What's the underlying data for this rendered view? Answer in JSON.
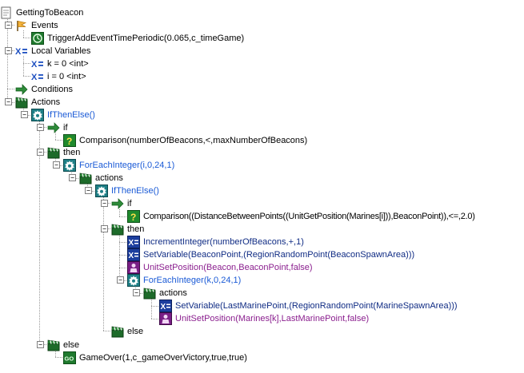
{
  "tree": {
    "root": "GettingToBeacon",
    "events_label": "Events",
    "event_call": "TriggerAddEventTimePeriodic(0.065,c_timeGame)",
    "locals_label": "Local Variables",
    "var_k": "k = 0 <int>",
    "var_i": "i = 0 <int>",
    "conditions_label": "Conditions",
    "actions_label": "Actions",
    "ifthen_outer": "IfThenElse()",
    "if_label": "if",
    "outer_comparison": "Comparison(numberOfBeacons,<,maxNumberOfBeacons)",
    "then_label": "then",
    "foreach_i": "ForEachInteger(i,0,24,1)",
    "actions_sub_label": "actions",
    "ifthen_inner": "IfThenElse()",
    "inner_if_label": "if",
    "inner_comparison": "Comparison((DistanceBetweenPoints((UnitGetPosition(Marines[i])),BeaconPoint)),<=,2.0)",
    "inner_then_label": "then",
    "increment": "IncrementInteger(numberOfBeacons,+,1)",
    "setvar_beacon": "SetVariable(BeaconPoint,(RegionRandomPoint(BeaconSpawnArea)))",
    "unitsetpos_beacon": "UnitSetPosition(Beacon,BeaconPoint,false)",
    "foreach_k": "ForEachInteger(k,0,24,1)",
    "actions_k_label": "actions",
    "setvar_lastmarine": "SetVariable(LastMarinePoint,(RegionRandomPoint(MarineSpawnArea)))",
    "unitsetpos_marines": "UnitSetPosition(Marines[k],LastMarinePoint,false)",
    "inner_else_label": "else",
    "outer_else_label": "else",
    "gameover": "GameOver(1,c_gameOverVictory,true,true)"
  },
  "colors": {
    "control_flow": "#1a5ad6",
    "variable_action": "#102c84",
    "unit_action": "#8a1e8e",
    "text": "#000000"
  },
  "icons": {
    "trigger": "trigger-icon",
    "events": "flag-icon",
    "timer": "timer-icon",
    "locals": "variable-icon",
    "conditions": "arrow-icon",
    "actions": "clapperboard-icon",
    "ifthenelse": "gear-icon",
    "comparison": "question-icon",
    "setvar": "set-variable-icon",
    "unit": "unit-icon",
    "gameover": "game-over-icon"
  }
}
